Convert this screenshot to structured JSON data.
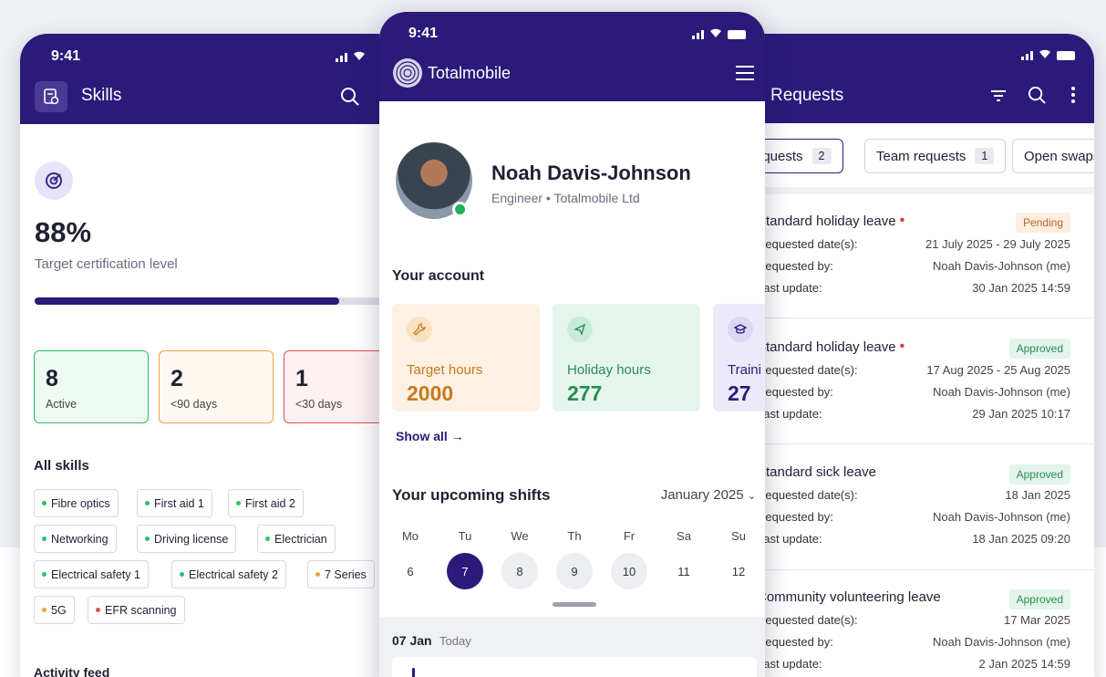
{
  "status_time": "9:41",
  "skills": {
    "title": "Skills",
    "percent": "88%",
    "percent_label": "Target certification level",
    "progress": 0.88,
    "stats": [
      {
        "value": "8",
        "label": "Active",
        "color": "#2fbf6a"
      },
      {
        "value": "2",
        "label": "<90 days",
        "color": "#f0a040"
      },
      {
        "value": "1",
        "label": "<30 days",
        "color": "#e05050"
      }
    ],
    "all_skills_heading": "All skills",
    "chips": [
      {
        "label": "Fibre optics",
        "dot": "#2fbf6a"
      },
      {
        "label": "First aid 1",
        "dot": "#2fbf6a"
      },
      {
        "label": "First aid 2",
        "dot": "#2fbf6a"
      },
      {
        "label": "Networking",
        "dot": "#2fbf6a"
      },
      {
        "label": "Driving license",
        "dot": "#2fbf6a"
      },
      {
        "label": "Electrician",
        "dot": "#2fbf6a"
      },
      {
        "label": "Electrical safety 1",
        "dot": "#2fbf6a"
      },
      {
        "label": "Electrical safety 2",
        "dot": "#2fbf6a"
      },
      {
        "label": "7 Series",
        "dot": "#f0a040"
      },
      {
        "label": "5G",
        "dot": "#f0a040"
      },
      {
        "label": "EFR scanning",
        "dot": "#e05050"
      }
    ],
    "activity_heading": "Activity feed"
  },
  "profile": {
    "brand": "Totalmobile",
    "name": "Noah Davis-Johnson",
    "role": "Engineer • Totalmobile Ltd",
    "account_heading": "Your account",
    "cards": [
      {
        "label": "Target hours",
        "value": "2000",
        "icon": "wrench-icon",
        "bg": "#fdf1e3",
        "color": "#c67a1d"
      },
      {
        "label": "Holiday hours",
        "value": "277",
        "icon": "plane-icon",
        "bg": "#e4f6ec",
        "color": "#2a8a55"
      },
      {
        "label": "Traini",
        "value": "27",
        "icon": "graduation-cap-icon",
        "bg": "#eceaf8",
        "color": "#2b1a7a"
      }
    ],
    "show_all": "Show all →",
    "shifts_heading": "Your upcoming shifts",
    "month": "January 2025",
    "weekdays": [
      "Mo",
      "Tu",
      "We",
      "Th",
      "Fr",
      "Sa",
      "Su"
    ],
    "days": [
      "6",
      "7",
      "8",
      "9",
      "10",
      "11",
      "12"
    ],
    "selected_day": "7",
    "today_date": "07 Jan",
    "today_label": "Today"
  },
  "requests": {
    "title": "Requests",
    "tabs": [
      {
        "label": "requests",
        "count": "2"
      },
      {
        "label": "Team requests",
        "count": "1"
      },
      {
        "label": "Open swaps",
        "count": ""
      }
    ],
    "keys": {
      "dates": "Requested date(s):",
      "by": "Requested by:",
      "update": "Last update:"
    },
    "items": [
      {
        "title": "Standard holiday leave",
        "dot": "•",
        "status": "Pending",
        "dates": "21 July 2025 - 29 July 2025",
        "by": "Noah Davis-Johnson (me)",
        "update": "30 Jan 2025 14:59"
      },
      {
        "title": "Standard holiday leave",
        "dot": "•",
        "status": "Approved",
        "dates": "17 Aug 2025 - 25 Aug 2025",
        "by": "Noah Davis-Johnson (me)",
        "update": "29 Jan 2025 10:17"
      },
      {
        "title": "Standard sick leave",
        "dot": "",
        "status": "Approved",
        "dates": "18 Jan 2025",
        "by": "Noah Davis-Johnson (me)",
        "update": "18 Jan 2025 09:20"
      },
      {
        "title": "Community volunteering leave",
        "dot": "",
        "status": "Approved",
        "dates": "17 Mar 2025",
        "by": "Noah Davis-Johnson (me)",
        "update": "2 Jan 2025 14:59"
      }
    ]
  }
}
